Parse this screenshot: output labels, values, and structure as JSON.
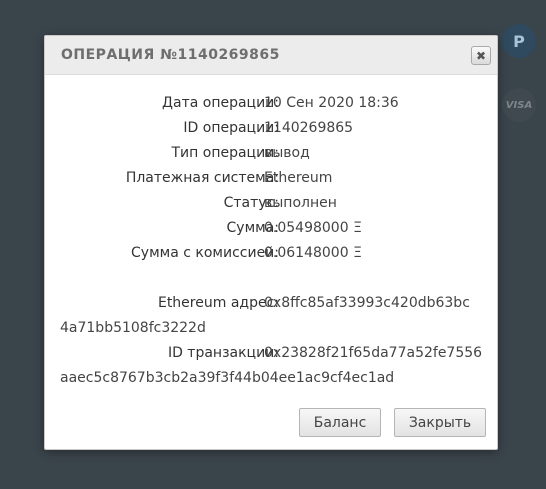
{
  "background": {
    "badge_letter": "P",
    "visa_label": "VISA"
  },
  "modal": {
    "title": "ОПЕРАЦИЯ №1140269865",
    "close_glyph": "✖",
    "rows": [
      {
        "label": "Дата операции:",
        "value": "10 Сен 2020 18:36"
      },
      {
        "label": "ID операции:",
        "value": "1140269865"
      },
      {
        "label": "Тип операции:",
        "value": "вывод"
      },
      {
        "label": "Платежная система:",
        "value": "Ethereum"
      },
      {
        "label": "Статус:",
        "value": "выполнен"
      },
      {
        "label": "Сумма:",
        "value": "0.05498000 Ξ"
      },
      {
        "label": "Сумма с комиссией:",
        "value": "0.06148000 Ξ"
      }
    ],
    "address": {
      "label": "Ethereum адрес:",
      "line1": "0x8ffc85af33993c420db63bc",
      "line2": "4a71bb5108fc3222d"
    },
    "transaction": {
      "label": "ID транзакции:",
      "line1": "0x23828f21f65da77a52fe7556",
      "line2": "aaec5c8767b3cb2a39f3f44b04ee1ac9cf4ec1ad"
    },
    "buttons": {
      "balance": "Баланс",
      "close": "Закрыть"
    }
  }
}
